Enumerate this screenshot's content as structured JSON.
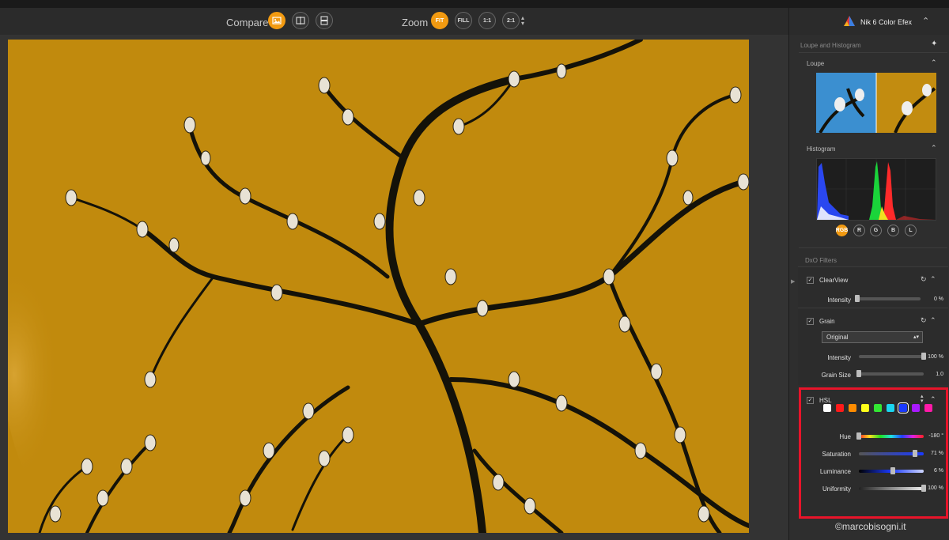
{
  "toolbar": {
    "compare_label": "Compare",
    "zoom_label": "Zoom",
    "zoom_options": [
      "FIT",
      "FILL",
      "1:1",
      "2:1"
    ],
    "zoom_selected": "FIT"
  },
  "app": {
    "name": "Nik 6 Color Efex"
  },
  "panel": {
    "loupe_histogram_title": "Loupe and Histogram",
    "loupe_title": "Loupe",
    "histogram_title": "Histogram",
    "channels": [
      "RGB",
      "R",
      "G",
      "B",
      "L"
    ],
    "channel_selected": "RGB",
    "dxo_filters_title": "DxO Filters"
  },
  "filters": {
    "clearview": {
      "name": "ClearView",
      "intensity_label": "Intensity",
      "intensity_value": "0 %",
      "intensity": 0
    },
    "grain": {
      "name": "Grain",
      "type_value": "Original",
      "intensity_label": "Intensity",
      "intensity_value": "100 %",
      "intensity": 1.0,
      "grain_size_label": "Grain Size",
      "grain_size_value": "1.0",
      "grain_size": 0.0
    },
    "hsl": {
      "name": "HSL",
      "swatches": [
        "#ffffff",
        "#ff1a1a",
        "#ff8c00",
        "#ffff1a",
        "#33e633",
        "#1ad5f0",
        "#1a3aff",
        "#a91aff",
        "#ff1aa8"
      ],
      "selected_swatch": 6,
      "hue_label": "Hue",
      "hue_value": "-180 °",
      "hue": 0.0,
      "saturation_label": "Saturation",
      "saturation_value": "71 %",
      "saturation": 0.86,
      "luminance_label": "Luminance",
      "luminance_value": "6 %",
      "luminance": 0.53,
      "uniformity_label": "Uniformity",
      "uniformity_value": "100 %",
      "uniformity": 1.0
    }
  },
  "watermark": "©marcobisogni.it"
}
